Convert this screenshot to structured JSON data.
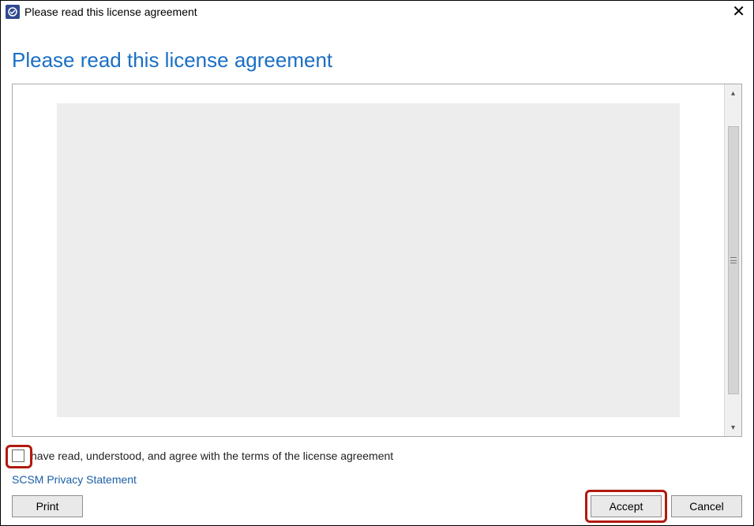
{
  "titlebar": {
    "title": "Please read this license agreement"
  },
  "heading": "Please read this license agreement",
  "agree": {
    "label": "have read, understood, and agree with the terms of the license agreement",
    "checked": false
  },
  "privacy_link": "SCSM Privacy Statement",
  "buttons": {
    "print": "Print",
    "accept": "Accept",
    "cancel": "Cancel"
  }
}
